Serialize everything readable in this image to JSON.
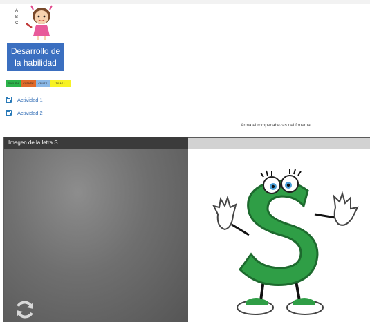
{
  "header": {
    "abc_letters": [
      "A",
      "B",
      "C"
    ]
  },
  "skill_button": {
    "label_line1": "Desarrollo de",
    "label_line2": "la habilidad"
  },
  "legend": [
    {
      "label": "ENGLISH",
      "color": "#2cb34a"
    },
    {
      "label": "CASA DE",
      "color": "#e06a2a"
    },
    {
      "label": "CRUZ-1",
      "color": "#8ab8e6"
    },
    {
      "label": "TICAS-I",
      "color": "#f7f225"
    }
  ],
  "activities": [
    {
      "label": "Actividad 1"
    },
    {
      "label": "Actividad 2"
    }
  ],
  "puzzle": {
    "caption": "Arma el rompecabezas del fonema",
    "left_title": "Imagen de la letra S"
  },
  "colors": {
    "button_blue": "#3b6fc0",
    "activity_icon": "#2a7ab8",
    "letter_green": "#2f9e46"
  },
  "icons": [
    "girl-mascot-icon",
    "briefcase-icon",
    "refresh-icon",
    "letter-s-character-icon"
  ]
}
